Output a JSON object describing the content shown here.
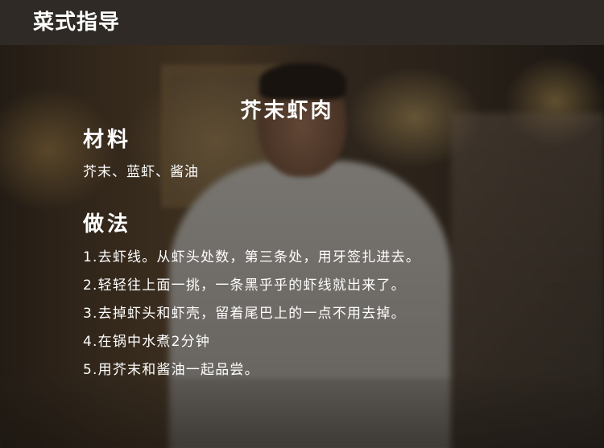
{
  "header": {
    "title": "菜式指导"
  },
  "recipe": {
    "dish_name": "芥末虾肉",
    "ingredients_heading": "材料",
    "ingredients": "芥末、蓝虾、酱油",
    "method_heading": "做法",
    "steps": [
      "1.去虾线。从虾头处数，第三条处，用牙签扎进去。",
      "2.轻轻往上面一挑，一条黑乎乎的虾线就出来了。",
      "3.去掉虾头和虾壳，留着尾巴上的一点不用去掉。",
      "4.在锅中水煮2分钟",
      "5.用芥末和酱油一起品尝。"
    ]
  },
  "background": {
    "image": "chef-photo"
  }
}
